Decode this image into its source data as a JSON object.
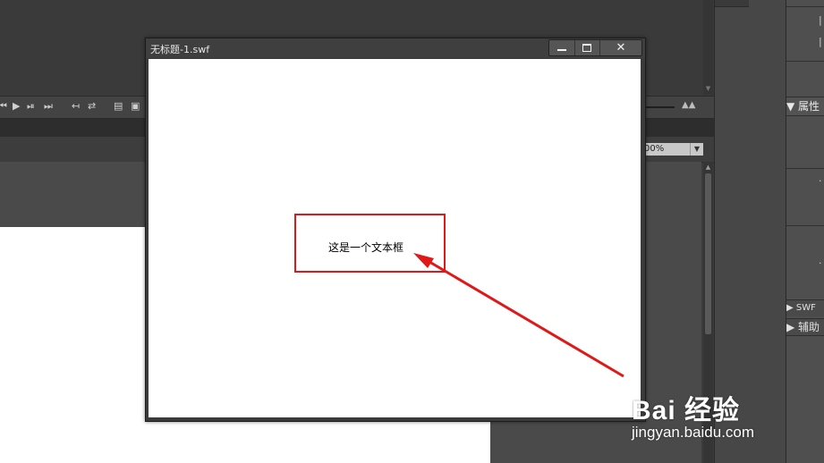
{
  "timeline": {
    "controls": [
      "⏮",
      "▶",
      "⏯",
      "⏭"
    ],
    "tools": [
      "↤",
      "⇄",
      "▤",
      "▣"
    ]
  },
  "stage": {
    "zoom": "00%"
  },
  "properties_panel": {
    "header": "▼ 属性",
    "swf_section": "▶ SWF",
    "help_section": "▶ 辅助"
  },
  "swf_window": {
    "title": "无标题-1.swf",
    "minimize_label": "",
    "maximize_label": "",
    "close_label": "✕",
    "text_field": "这是一个文本框"
  },
  "annotation": {
    "color": "#e01818"
  },
  "watermark": {
    "brand": "Bai 经验",
    "url": "jingyan.baidu.com"
  }
}
